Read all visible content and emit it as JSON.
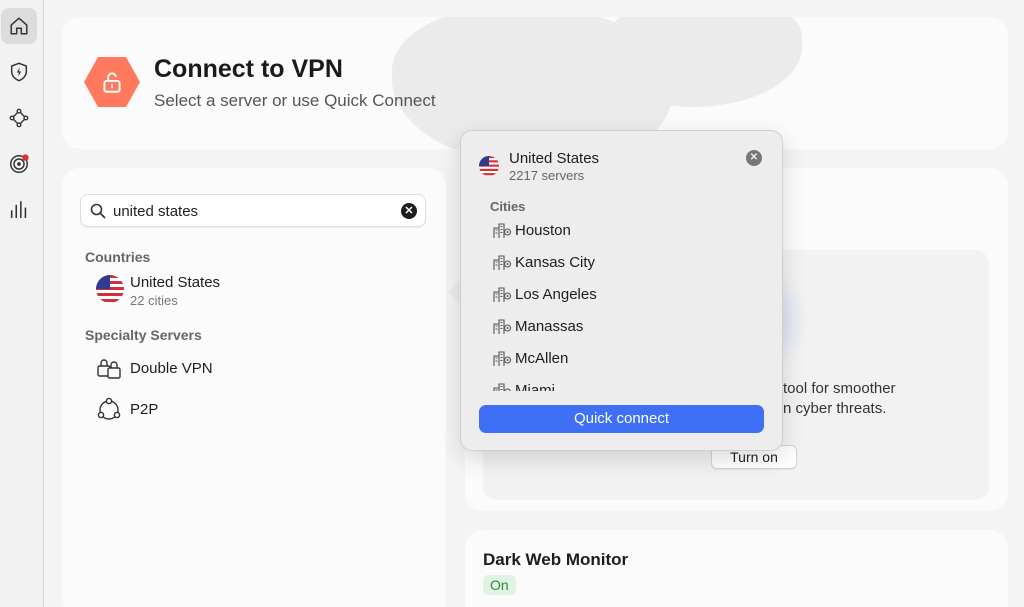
{
  "colors": {
    "accent": "#3e6ff5",
    "vpn_badge": "#ff7a5c",
    "status_on_bg": "#e1f3e3",
    "status_on_text": "#2e8a3e",
    "notification_dot": "#e0302f"
  },
  "sidebar": {
    "items": [
      {
        "name": "home",
        "icon": "home-icon",
        "active": true
      },
      {
        "name": "threat-protection",
        "icon": "shield-bolt-icon",
        "active": false
      },
      {
        "name": "meshnet",
        "icon": "meshnet-icon",
        "active": false
      },
      {
        "name": "dark-web-monitor",
        "icon": "target-icon",
        "active": false,
        "notification": true
      },
      {
        "name": "stats",
        "icon": "bar-stats-icon",
        "active": false
      }
    ]
  },
  "header": {
    "title": "Connect to VPN",
    "subtitle": "Select a server or use Quick Connect"
  },
  "search": {
    "value": "united states"
  },
  "countries": {
    "label": "Countries",
    "items": [
      {
        "name": "United States",
        "detail": "22 cities",
        "icon": "us-flag-icon"
      }
    ]
  },
  "specialty": {
    "label": "Specialty Servers",
    "items": [
      {
        "name": "Double VPN",
        "icon": "double-vpn-icon"
      },
      {
        "name": "P2P",
        "icon": "p2p-icon"
      }
    ]
  },
  "feature_card": {
    "text_line1": "tool for smoother",
    "text_line2": "n cyber threats.",
    "button": "Turn on"
  },
  "dark_web": {
    "title": "Dark Web Monitor",
    "status": "On"
  },
  "popover": {
    "country": "United States",
    "servers": "2217 servers",
    "cities_label": "Cities",
    "cities": [
      "Houston",
      "Kansas City",
      "Los Angeles",
      "Manassas",
      "McAllen",
      "Miami"
    ],
    "quick_connect": "Quick connect"
  }
}
